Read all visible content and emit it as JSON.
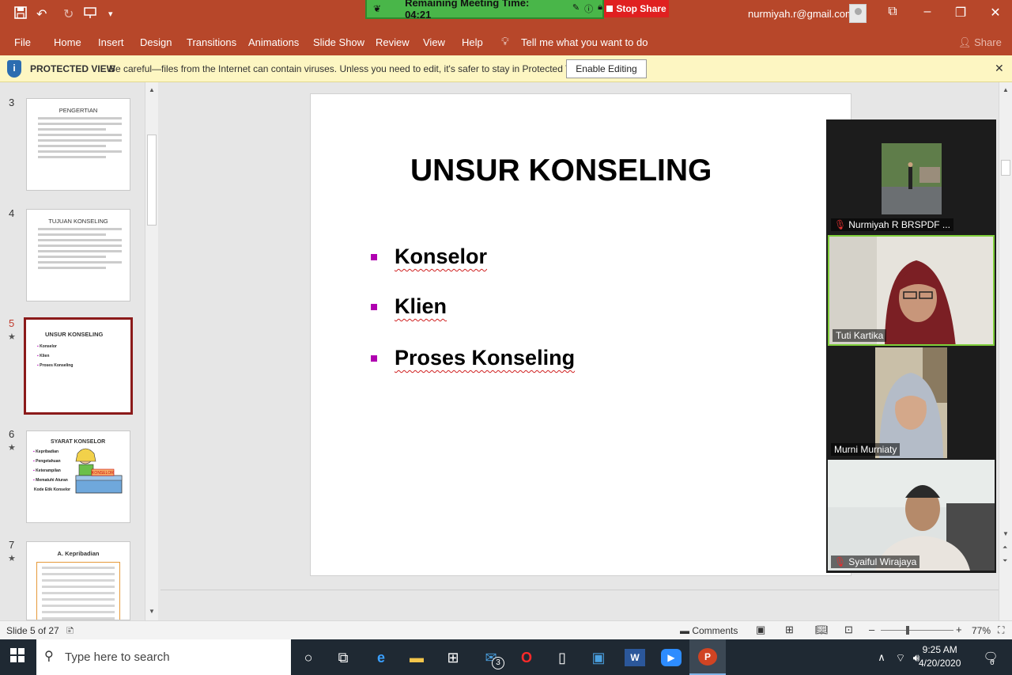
{
  "window": {
    "email": "nurmiyah.r@gmail.com"
  },
  "zoom_meeting": {
    "remaining_label": "Remaining Meeting Time: 04:21",
    "stop_share_label": "Stop Share"
  },
  "menu": {
    "items": [
      "File",
      "Home",
      "Insert",
      "Design",
      "Transitions",
      "Animations",
      "Slide Show",
      "Review",
      "View",
      "Help"
    ],
    "tell_me": "Tell me what you want to do",
    "share": "Share"
  },
  "protected_view": {
    "title": "PROTECTED VIEW",
    "message": "Be careful—files from the Internet can contain viruses. Unless you need to edit, it's safer to stay in Protected View.",
    "enable_button": "Enable Editing"
  },
  "thumbnails": [
    {
      "number": "3",
      "title": "PENGERTIAN"
    },
    {
      "number": "4",
      "title": "TUJUAN KONSELING"
    },
    {
      "number": "5",
      "title": "UNSUR KONSELING",
      "bullets": [
        "Konselor",
        "Klien",
        "Proses Konseling"
      ]
    },
    {
      "number": "6",
      "title": "SYARAT KONSELOR",
      "bullets": [
        "Kepribadian",
        "Pengetahuan",
        "Keterampilan",
        "Mematuhi Aturan",
        "Kode Etik Konselor"
      ],
      "sign": "KONSELOR"
    },
    {
      "number": "7",
      "title": "A.   Kepribadian"
    }
  ],
  "slide": {
    "title": "UNSUR KONSELING",
    "bullets": [
      "Konselor",
      "Klien",
      "Proses Konseling"
    ]
  },
  "participants": [
    {
      "name": "Nurmiyah R BRSPDF ...",
      "muted": true
    },
    {
      "name": "Tuti Kartika",
      "muted": false
    },
    {
      "name": "Murni Murniaty",
      "muted": false
    },
    {
      "name": "Syaiful Wirajaya",
      "muted": true
    }
  ],
  "statusbar": {
    "slide_indicator": "Slide 5 of 27",
    "comments": "Comments",
    "zoom": "77%"
  },
  "taskbar": {
    "search_placeholder": "Type here to search",
    "mail_badge": "3",
    "time": "9:25 AM",
    "date": "4/20/2020",
    "notification_count": "6"
  }
}
